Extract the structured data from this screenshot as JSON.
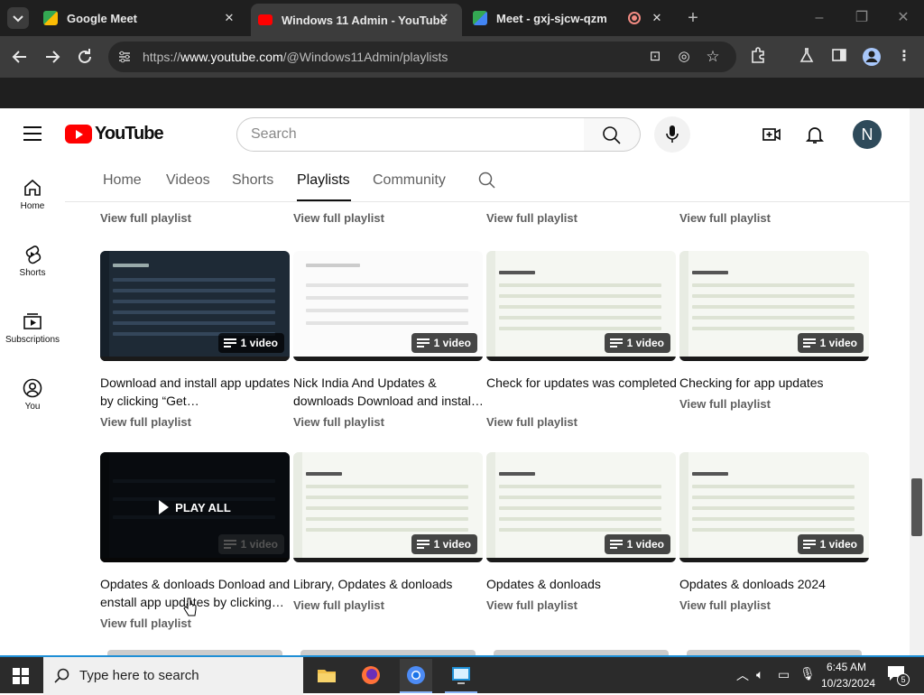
{
  "browser": {
    "tabs": [
      {
        "title": "Google Meet",
        "active": false
      },
      {
        "title": "Windows 11 Admin - YouTube",
        "active": true
      },
      {
        "title": "Meet - gxj-sjcw-qzm",
        "active": false
      }
    ],
    "url_prefix": "https://",
    "url_host": "www.youtube.com",
    "url_path": "/@Windows11Admin/playlists"
  },
  "youtube": {
    "logo_text": "YouTube",
    "search_placeholder": "Search",
    "avatar_letter": "N",
    "guide": [
      {
        "label": "Home",
        "icon": "home-icon"
      },
      {
        "label": "Shorts",
        "icon": "shorts-icon"
      },
      {
        "label": "Subscriptions",
        "icon": "subscriptions-icon"
      },
      {
        "label": "You",
        "icon": "you-icon"
      }
    ],
    "channel_tabs": [
      "Home",
      "Videos",
      "Shorts",
      "Playlists",
      "Community"
    ],
    "active_tab": "Playlists",
    "view_full_playlist": "View full playlist",
    "play_all": "PLAY ALL",
    "video_badge": "1 video",
    "row1": [
      {
        "title": "Download and install app updates by clicking “Get…",
        "thumb": "dark"
      },
      {
        "title": "Nick India And Updates & downloads Download and instal…",
        "thumb": "white"
      },
      {
        "title": "Check for updates was completed",
        "thumb": "light"
      },
      {
        "title": "Checking for app updates",
        "thumb": "light"
      }
    ],
    "row2": [
      {
        "title": "Opdates & donloads Donload and enstall app updates by clicking…",
        "thumb": "dark"
      },
      {
        "title": "Library, Opdates & donloads",
        "thumb": "light"
      },
      {
        "title": "Opdates & donloads",
        "thumb": "light"
      },
      {
        "title": "Opdates & donloads 2024",
        "thumb": "light"
      }
    ]
  },
  "taskbar": {
    "search_placeholder": "Type here to search",
    "time": "6:45 AM",
    "date": "10/23/2024",
    "notification_count": "5"
  },
  "colors": {
    "yt_red": "#ff0000",
    "accent_blue": "#1e8fd6",
    "chrome_dark": "#1f1f1f"
  }
}
